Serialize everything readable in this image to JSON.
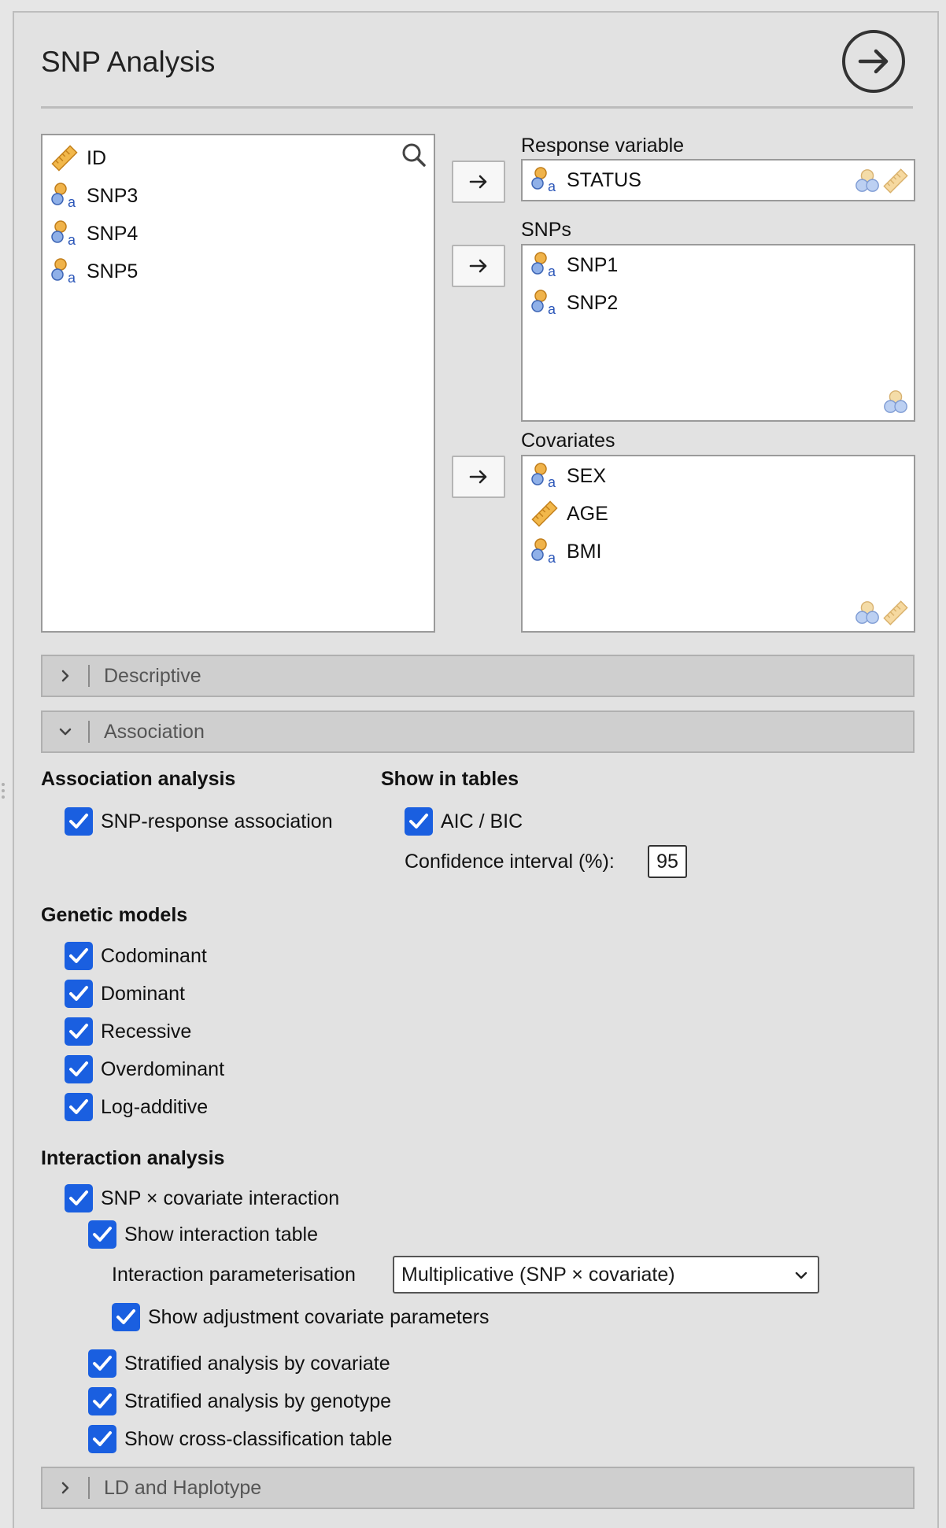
{
  "title": "SNP Analysis",
  "available_vars": [
    {
      "name": "ID",
      "icon": "ruler-icon"
    },
    {
      "name": "SNP3",
      "icon": "nominal-text-icon"
    },
    {
      "name": "SNP4",
      "icon": "nominal-text-icon"
    },
    {
      "name": "SNP5",
      "icon": "nominal-text-icon"
    }
  ],
  "response": {
    "label": "Response variable",
    "items": [
      "STATUS"
    ]
  },
  "snps": {
    "label": "SNPs",
    "items": [
      "SNP1",
      "SNP2"
    ]
  },
  "covariates": {
    "label": "Covariates",
    "items": [
      {
        "name": "SEX",
        "icon": "nominal-text-icon"
      },
      {
        "name": "AGE",
        "icon": "ruler-icon"
      },
      {
        "name": "BMI",
        "icon": "nominal-text-icon"
      }
    ]
  },
  "sections": {
    "descriptive": "Descriptive",
    "association": "Association",
    "ld": "LD and Haplotype"
  },
  "association": {
    "analysis_heading": "Association analysis",
    "snp_response": "SNP-response association",
    "tables_heading": "Show in tables",
    "aic_bic": "AIC / BIC",
    "ci_label": "Confidence interval (%):",
    "ci_value": "95",
    "models_heading": "Genetic models",
    "models": [
      "Codominant",
      "Dominant",
      "Recessive",
      "Overdominant",
      "Log-additive"
    ],
    "interaction_heading": "Interaction analysis",
    "snp_cov_interaction": "SNP × covariate interaction",
    "show_interaction_table": "Show interaction table",
    "param_label": "Interaction parameterisation",
    "param_value": "Multiplicative (SNP × covariate)",
    "show_adjustment": "Show adjustment covariate parameters",
    "stratified_cov": "Stratified analysis by covariate",
    "stratified_geno": "Stratified analysis by genotype",
    "cross_class": "Show cross-classification table"
  },
  "colors": {
    "checkbox": "#1a5fe0",
    "nominal_orange": "#e8a33a",
    "nominal_blue": "#6b93d6"
  }
}
